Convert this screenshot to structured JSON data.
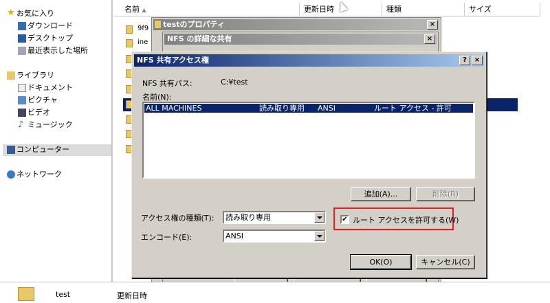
{
  "nav": {
    "favorites": "お気に入り",
    "downloads": "ダウンロード",
    "desktop": "デスクトップ",
    "recent": "最近表示した場所",
    "libraries": "ライブラリ",
    "documents": "ドキュメント",
    "pictures": "ピクチャ",
    "videos": "ビデオ",
    "music": "ミュージック",
    "computer": "コンピューター",
    "network": "ネットワーク"
  },
  "columns": {
    "name": "名前",
    "modified": "更新日時",
    "type": "種類",
    "size": "サイズ"
  },
  "files": {
    "f1": "9f9",
    "f2": "ine"
  },
  "bg_dialogs": {
    "props_title": "testのプロパティ",
    "nfs_adv_title": "NFS の詳細な共有",
    "close": "×"
  },
  "dialog": {
    "title": "NFS 共有アクセス権",
    "help": "?",
    "close": "×",
    "path_label": "NFS 共有パス:",
    "path_value": "C:¥test",
    "names_label": "名前(N):",
    "entry": {
      "name": "ALL MACHINES",
      "access": "読み取り専用",
      "encoding": "ANSI",
      "root": "ルート アクセス - 許可"
    },
    "add_button": "追加(A)...",
    "remove_button": "削除(R)",
    "access_type_label": "アクセス権の種類(T):",
    "access_type_value": "読み取り専用",
    "encode_label": "エンコード(E):",
    "encode_value": "ANSI",
    "root_checkbox_label": "ルート アクセスを許可する(W)",
    "root_checked": "✔",
    "ok_button": "OK(O)",
    "cancel_button": "キャンセル(C)"
  },
  "status": {
    "folder_name": "test",
    "modified_label": "更新日時"
  }
}
